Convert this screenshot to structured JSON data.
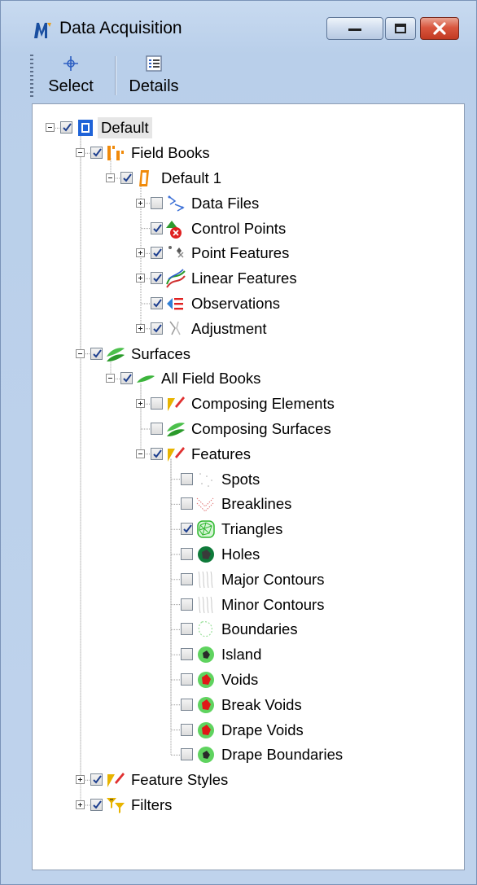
{
  "window": {
    "title": "Data Acquisition",
    "app_icon": "data-acquisition-icon",
    "controls": [
      "minimize-icon",
      "maximize-icon",
      "close-icon"
    ]
  },
  "toolbar": {
    "select_label": "Select",
    "details_label": "Details",
    "select_icon": "crosshair-icon",
    "details_icon": "details-list-icon"
  },
  "tree": {
    "nodes": [
      {
        "label": "Default",
        "level": 0,
        "expander": "minus",
        "checked": true,
        "icon": "database-icon",
        "selected": true
      },
      {
        "label": "Field Books",
        "level": 1,
        "expander": "minus",
        "checked": true,
        "icon": "field-books-icon"
      },
      {
        "label": "Default 1",
        "level": 2,
        "expander": "minus",
        "checked": true,
        "icon": "field-book-icon"
      },
      {
        "label": "Data Files",
        "level": 3,
        "expander": "plus",
        "checked": false,
        "icon": "data-files-icon"
      },
      {
        "label": "Control Points",
        "level": 3,
        "expander": null,
        "checked": true,
        "icon": "control-points-icon"
      },
      {
        "label": "Point Features",
        "level": 3,
        "expander": "plus",
        "checked": true,
        "icon": "point-features-icon"
      },
      {
        "label": "Linear Features",
        "level": 3,
        "expander": "plus",
        "checked": true,
        "icon": "linear-features-icon"
      },
      {
        "label": "Observations",
        "level": 3,
        "expander": null,
        "checked": true,
        "icon": "observations-icon"
      },
      {
        "label": "Adjustment",
        "level": 3,
        "expander": "plus",
        "checked": true,
        "icon": "adjustment-icon"
      },
      {
        "label": "Surfaces",
        "level": 1,
        "expander": "minus",
        "checked": true,
        "icon": "surfaces-icon"
      },
      {
        "label": "All Field Books",
        "level": 2,
        "expander": "minus",
        "checked": true,
        "icon": "surface-icon"
      },
      {
        "label": "Composing Elements",
        "level": 3,
        "expander": "plus",
        "checked": false,
        "icon": "composing-elements-icon"
      },
      {
        "label": "Composing Surfaces",
        "level": 3,
        "expander": null,
        "checked": false,
        "icon": "composing-surfaces-icon"
      },
      {
        "label": "Features",
        "level": 3,
        "expander": "minus",
        "checked": true,
        "icon": "features-icon"
      },
      {
        "label": "Spots",
        "level": 4,
        "expander": null,
        "checked": false,
        "icon": "spots-icon"
      },
      {
        "label": "Breaklines",
        "level": 4,
        "expander": null,
        "checked": false,
        "icon": "breaklines-icon"
      },
      {
        "label": "Triangles",
        "level": 4,
        "expander": null,
        "checked": true,
        "icon": "triangles-icon"
      },
      {
        "label": "Holes",
        "level": 4,
        "expander": null,
        "checked": false,
        "icon": "holes-icon"
      },
      {
        "label": "Major Contours",
        "level": 4,
        "expander": null,
        "checked": false,
        "icon": "major-contours-icon"
      },
      {
        "label": "Minor Contours",
        "level": 4,
        "expander": null,
        "checked": false,
        "icon": "minor-contours-icon"
      },
      {
        "label": "Boundaries",
        "level": 4,
        "expander": null,
        "checked": false,
        "icon": "boundaries-icon"
      },
      {
        "label": "Island",
        "level": 4,
        "expander": null,
        "checked": false,
        "icon": "island-icon"
      },
      {
        "label": "Voids",
        "level": 4,
        "expander": null,
        "checked": false,
        "icon": "voids-icon"
      },
      {
        "label": "Break Voids",
        "level": 4,
        "expander": null,
        "checked": false,
        "icon": "break-voids-icon"
      },
      {
        "label": "Drape Voids",
        "level": 4,
        "expander": null,
        "checked": false,
        "icon": "drape-voids-icon"
      },
      {
        "label": "Drape Boundaries",
        "level": 4,
        "expander": null,
        "checked": false,
        "icon": "drape-boundaries-icon"
      },
      {
        "label": "Feature Styles",
        "level": 1,
        "expander": "plus",
        "checked": true,
        "icon": "feature-styles-icon"
      },
      {
        "label": "Filters",
        "level": 1,
        "expander": "plus",
        "checked": true,
        "icon": "filters-icon"
      }
    ]
  }
}
